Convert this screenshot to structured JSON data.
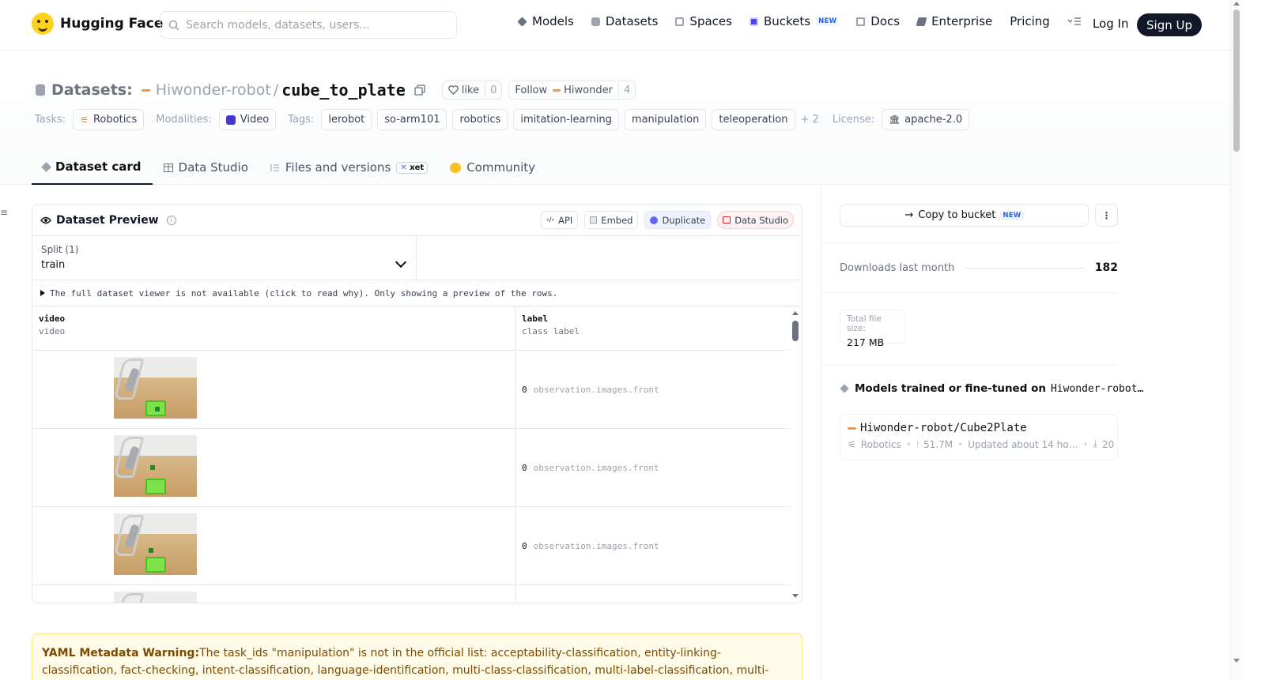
{
  "nav": {
    "logo_text": "Hugging Face",
    "search_placeholder": "Search models, datasets, users...",
    "links": [
      {
        "label": "Models",
        "icon": "cube-icon",
        "color": "#6b7280"
      },
      {
        "label": "Datasets",
        "icon": "database-icon",
        "color": "#9ca3af"
      },
      {
        "label": "Spaces",
        "icon": "grid-icon",
        "color": "#9ca3af"
      },
      {
        "label": "Buckets",
        "icon": "bucket-icon",
        "color": "#4f46e5",
        "badge": "NEW"
      },
      {
        "label": "Docs",
        "icon": "book-icon",
        "color": "#9ca3af"
      },
      {
        "label": "Enterprise",
        "icon": "building-icon",
        "color": "#6b7280"
      },
      {
        "label": "Pricing"
      }
    ],
    "login": "Log In",
    "signup": "Sign Up"
  },
  "header": {
    "datasets_label": "Datasets:",
    "owner": "Hiwonder-robot",
    "separator": "/",
    "repo": "cube_to_plate",
    "like_label": "like",
    "like_count": "0",
    "follow_label": "Follow",
    "follow_org": "Hiwonder",
    "follow_count": "4",
    "tasks_label": "Tasks:",
    "task": "Robotics",
    "modalities_label": "Modalities:",
    "modality": "Video",
    "tags_label": "Tags:",
    "tags": [
      "lerobot",
      "so-arm101",
      "robotics",
      "imitation-learning",
      "manipulation",
      "teleoperation"
    ],
    "more_tags": "+ 2",
    "license_label": "License:",
    "license": "apache-2.0"
  },
  "tabs": [
    {
      "label": "Dataset card",
      "active": true
    },
    {
      "label": "Data Studio"
    },
    {
      "label": "Files and versions",
      "badge": "xet"
    },
    {
      "label": "Community"
    }
  ],
  "preview": {
    "title": "Dataset Preview",
    "buttons": {
      "api": "API",
      "embed": "Embed",
      "duplicate": "Duplicate",
      "data_studio": "Data Studio"
    },
    "split_label": "Split (1)",
    "split_value": "train",
    "notice": "The full dataset viewer is not available (click to read why). Only showing a preview of the rows.",
    "columns": [
      {
        "name": "video",
        "type": "video"
      },
      {
        "name": "label",
        "type": "class label"
      }
    ],
    "rows": [
      {
        "index": "0",
        "label": "observation.images.front"
      },
      {
        "index": "0",
        "label": "observation.images.front"
      },
      {
        "index": "0",
        "label": "observation.images.front"
      }
    ]
  },
  "warning": {
    "title": "YAML Metadata Warning:",
    "text": "The task_ids \"manipulation\" is not in the official list: acceptability-classification, entity-linking-classification, fact-checking, intent-classification, language-identification, multi-class-classification, multi-label-classification, multi-input-text-classification"
  },
  "sidebar": {
    "copy_bucket": "Copy to bucket",
    "copy_badge": "NEW",
    "downloads_label": "Downloads last month",
    "downloads_value": "182",
    "size_label": "Total file size:",
    "size_value": "217 MB",
    "models_title": "Models trained or fine-tuned on",
    "models_repo": "Hiwonder-robot…",
    "model": {
      "name": "Hiwonder-robot/Cube2Plate",
      "task": "Robotics",
      "params": "51.7M",
      "updated": "Updated about 14 ho…",
      "downloads": "20"
    }
  }
}
